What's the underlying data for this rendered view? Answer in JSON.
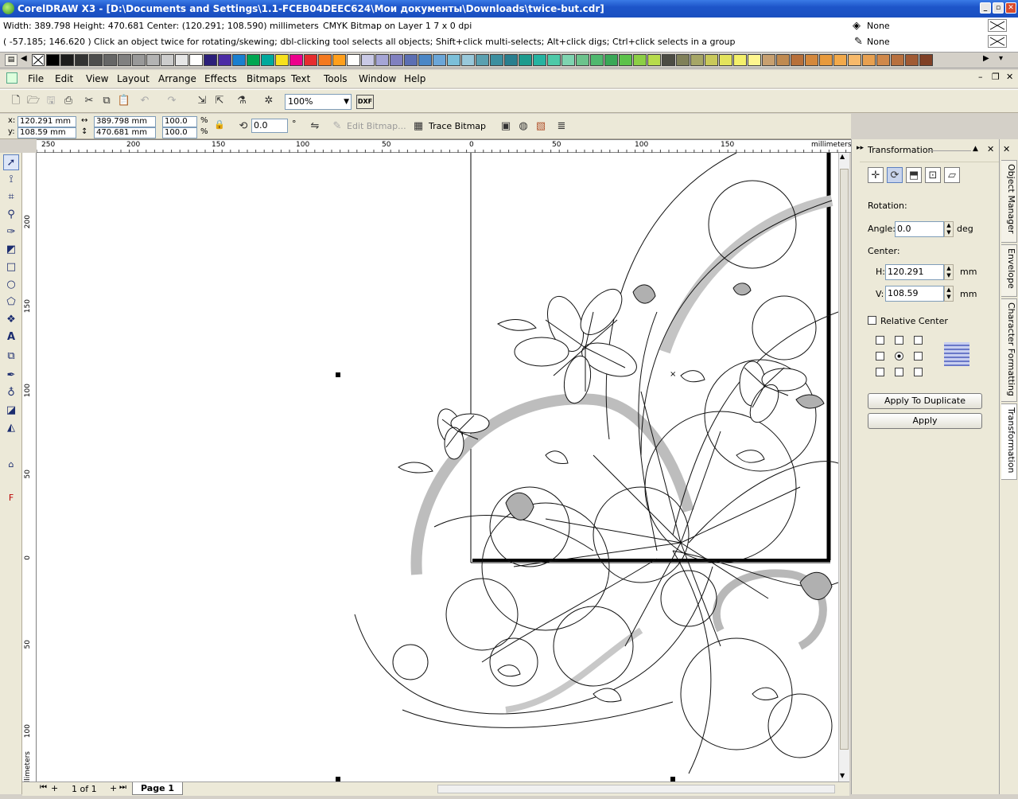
{
  "window": {
    "title": "CorelDRAW X3 - [D:\\Documents and Settings\\1.1-FCEB04DEEC624\\Мои документы\\Downloads\\twice-but.cdr]",
    "controls": [
      "_",
      "▫",
      "✕"
    ]
  },
  "status": {
    "dimensions": "Width: 389.798  Height: 470.681  Center: (120.291; 108.590)  millimeters",
    "object_info": "CMYK Bitmap on Layer 1 7 x 0 dpi",
    "cursor": "( -57.185; 146.620 )",
    "hint": "Click an object twice for rotating/skewing; dbl-clicking tool selects all objects; Shift+click multi-selects; Alt+click digs; Ctrl+click selects in a group",
    "fill_label": "None",
    "outline_label": "None"
  },
  "palette": {
    "colors": [
      "#000000",
      "#1c1c1c",
      "#333333",
      "#4d4d4d",
      "#666666",
      "#808080",
      "#999999",
      "#b3b3b3",
      "#cccccc",
      "#e6e6e6",
      "#ffffff",
      "#2b1f7a",
      "#4b2ba5",
      "#1a7fd0",
      "#00a651",
      "#00a99d",
      "#f7e11d",
      "#ec008c",
      "#e62d2f",
      "#f47920",
      "#ff9f1c",
      "#ffffff",
      "#c9c9e6",
      "#a5a5d6",
      "#8080c0",
      "#5c6fb3",
      "#4a86c6",
      "#6ba6d8",
      "#7bbfd9",
      "#98c8da",
      "#5aa0b0",
      "#3c8fa0",
      "#2a7f8f",
      "#1d9b8e",
      "#26b3a1",
      "#4dc9a8",
      "#7ed4b0",
      "#6cc38c",
      "#4fb86e",
      "#3aa857",
      "#5cc24a",
      "#8ccf45",
      "#b7dc4c",
      "#4c4c44",
      "#808059",
      "#a6a666",
      "#c9c95a",
      "#e3e35c",
      "#f4f06a",
      "#fff68f",
      "#c8a070",
      "#c08a50",
      "#b8703a",
      "#d4883c",
      "#e89a3c",
      "#f2a94a",
      "#f7b96a",
      "#e8a050",
      "#d0884a",
      "#b8703e",
      "#a05a34",
      "#804026"
    ]
  },
  "menu": {
    "items": [
      "File",
      "Edit",
      "View",
      "Layout",
      "Arrange",
      "Effects",
      "Bitmaps",
      "Text",
      "Tools",
      "Window",
      "Help"
    ]
  },
  "standard_toolbar": {
    "zoom": "100%",
    "dxf_label": "DXF"
  },
  "property_bar": {
    "x": "120.291 mm",
    "y": "108.59 mm",
    "width": "389.798 mm",
    "height": "470.681 mm",
    "scale_x": "100.0",
    "scale_y": "100.0",
    "percent": "%",
    "angle": "0.0",
    "degree": "°",
    "x_label": "x:",
    "y_label": "y:",
    "edit_bitmap": "Edit Bitmap...",
    "trace_bitmap": "Trace Bitmap"
  },
  "rulers": {
    "horizontal_labels": [
      "250",
      "200",
      "150",
      "100",
      "50",
      "0",
      "50",
      "100",
      "150"
    ],
    "units": "millimeters",
    "vertical_labels": [
      "200",
      "150",
      "100",
      "50",
      "0",
      "50",
      "100"
    ],
    "vertical_units": "millimeters"
  },
  "page_nav": {
    "count": "1 of 1",
    "page_tab": "Page 1"
  },
  "docker": {
    "title": "Transformation",
    "rotation_label": "Rotation:",
    "angle_label": "Angle:",
    "angle_value": "0.0",
    "angle_unit": "deg",
    "center_label": "Center:",
    "h_label": "H:",
    "h_value": "120.291",
    "v_label": "V:",
    "v_value": "108.59",
    "unit_mm": "mm",
    "relative_center": "Relative Center",
    "apply_duplicate": "Apply To Duplicate",
    "apply": "Apply"
  },
  "docker_tabs": [
    "Object Manager",
    "Envelope",
    "Character Formatting",
    "Transformation"
  ]
}
